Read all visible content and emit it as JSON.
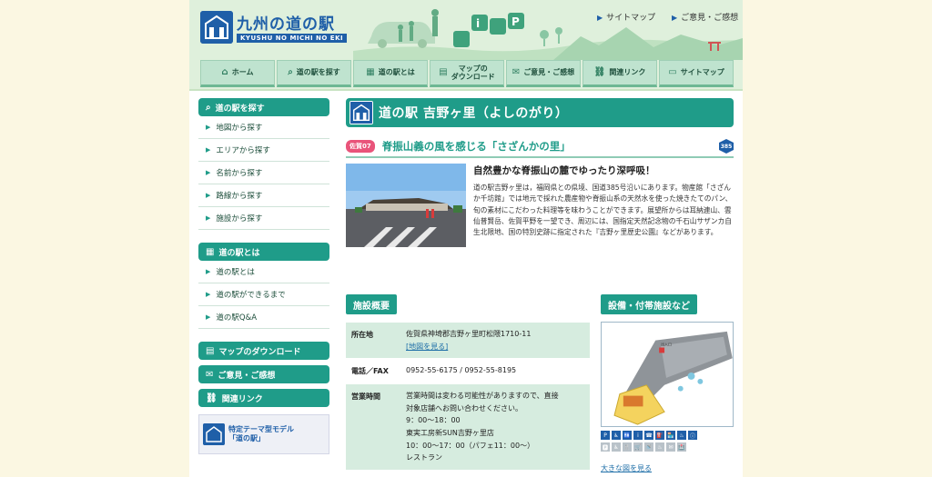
{
  "site": {
    "title": "九州の道の駅",
    "subtitle": "KYUSHU NO MICHI NO EKI",
    "top_links": [
      "サイトマップ",
      "ご意見・ご感想"
    ]
  },
  "global_nav": [
    {
      "label": "ホーム",
      "icon": "home-icon"
    },
    {
      "label": "道の駅を探す",
      "icon": "search-icon"
    },
    {
      "label": "道の駅とは",
      "icon": "station-icon"
    },
    {
      "label": "マップの\nダウンロード",
      "icon": "document-icon"
    },
    {
      "label": "ご意見・ご感想",
      "icon": "mail-icon"
    },
    {
      "label": "関連リンク",
      "icon": "link-icon"
    },
    {
      "label": "サイトマップ",
      "icon": "sitemap-icon"
    }
  ],
  "sidebar": {
    "search_title": "道の駅を探す",
    "search_items": [
      "地図から探す",
      "エリアから探す",
      "名前から探す",
      "路線から探す",
      "施設から探す"
    ],
    "about_title": "道の駅とは",
    "about_items": [
      "道の駅とは",
      "道の駅ができるまで",
      "道の駅Q&A"
    ],
    "download_label": "マップのダウンロード",
    "feedback_label": "ご意見・ご感想",
    "links_label": "関連リンク",
    "banner_text_1": "特定テーマ型モデル",
    "banner_text_2": "「道の駅」"
  },
  "main": {
    "page_title": "道の駅 吉野ヶ里（よしのがり）",
    "badge": "佐賀07",
    "catch": "脊振山義の風を感じる「さざんかの里」",
    "route_number": "385",
    "intro_heading": "自然豊かな脊振山の麓でゆったり深呼吸！",
    "intro_body": "道の駅吉野ヶ里は，福岡県との県境、国道385号沿いにあります。物産館「さざんか千坊館」では地元で採れた農産物や脊振山系の天然水を使った焼きたてのパン、旬の素材にこだわった料理等を味わうことができます。展望所からは耳納連山、雲仙普賢岳、佐賀平野を一望でき、周辺には、国指定天然記念物の千石山サザンカ自生北限地、国の特別史跡に指定された『吉野ヶ里歴史公園』などがあります。",
    "facility_heading": "施設概要",
    "amenities_heading": "設備・付帯施設など",
    "facts": [
      {
        "key": "所在地",
        "lines": [
          "佐賀県神埼郡吉野ヶ里町松隈1710-11"
        ],
        "link": "[地図を見る]"
      },
      {
        "key": "電話／FAX",
        "lines": [
          "0952-55-6175 / 0952-55-8195"
        ],
        "link": ""
      },
      {
        "key": "営業時間",
        "lines": [
          "営業時間は変わる可能性がありますので、直接",
          "対象店舗へお問い合わせください。",
          "9：00～18：00",
          "東実工房新SUN吉野ヶ里店",
          "10：00～17：00（パフェ11：00～）",
          "レストラン"
        ],
        "link": ""
      }
    ],
    "map_labels": {
      "entrance": "出入口"
    },
    "big_map_link": "大きな図を見る"
  },
  "amenity_icons_row1": [
    "P",
    "♿",
    "🚻",
    "i",
    "☎",
    "⛽",
    "🏪",
    "♨",
    "ⓘ"
  ],
  "amenity_icons_row2": [
    "🅿",
    "♿",
    "🍴",
    "🛒",
    "🚿",
    "♨",
    "✉",
    "🏥"
  ],
  "colors": {
    "accent": "#1f9c89",
    "brand": "#1f5fa8",
    "badge": "#e9547a",
    "background": "#fbf7e2"
  }
}
